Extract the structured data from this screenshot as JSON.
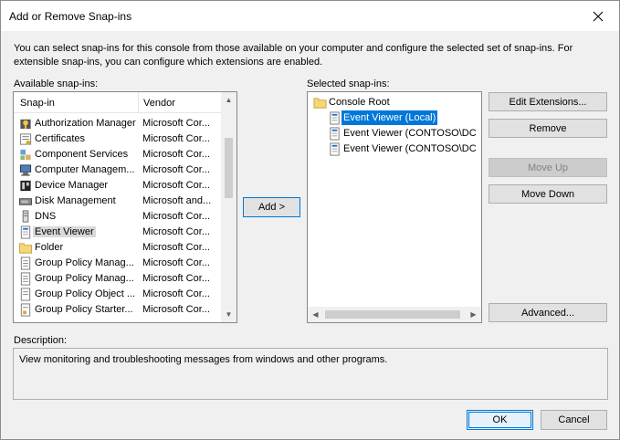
{
  "window": {
    "title": "Add or Remove Snap-ins"
  },
  "intro": "You can select snap-ins for this console from those available on your computer and configure the selected set of snap-ins. For extensible snap-ins, you can configure which extensions are enabled.",
  "available": {
    "label": "Available snap-ins:",
    "columns": {
      "snapin": "Snap-in",
      "vendor": "Vendor"
    },
    "items": [
      {
        "name": "Authorization Manager",
        "vendor": "Microsoft Cor...",
        "icon": "authorization-manager-icon"
      },
      {
        "name": "Certificates",
        "vendor": "Microsoft Cor...",
        "icon": "certificates-icon"
      },
      {
        "name": "Component Services",
        "vendor": "Microsoft Cor...",
        "icon": "component-services-icon"
      },
      {
        "name": "Computer Managem...",
        "vendor": "Microsoft Cor...",
        "icon": "computer-management-icon"
      },
      {
        "name": "Device Manager",
        "vendor": "Microsoft Cor...",
        "icon": "device-manager-icon"
      },
      {
        "name": "Disk Management",
        "vendor": "Microsoft and...",
        "icon": "disk-management-icon"
      },
      {
        "name": "DNS",
        "vendor": "Microsoft Cor...",
        "icon": "dns-icon"
      },
      {
        "name": "Event Viewer",
        "vendor": "Microsoft Cor...",
        "icon": "event-viewer-icon"
      },
      {
        "name": "Folder",
        "vendor": "Microsoft Cor...",
        "icon": "folder-icon"
      },
      {
        "name": "Group Policy Manag...",
        "vendor": "Microsoft Cor...",
        "icon": "group-policy-icon"
      },
      {
        "name": "Group Policy Manag...",
        "vendor": "Microsoft Cor...",
        "icon": "group-policy-icon"
      },
      {
        "name": "Group Policy Object ...",
        "vendor": "Microsoft Cor...",
        "icon": "group-policy-object-icon"
      },
      {
        "name": "Group Policy Starter...",
        "vendor": "Microsoft Cor...",
        "icon": "group-policy-starter-icon"
      }
    ]
  },
  "add_button": "Add >",
  "selected": {
    "label": "Selected snap-ins:",
    "root": "Console Root",
    "items": [
      "Event Viewer (Local)",
      "Event Viewer (CONTOSO\\DC",
      "Event Viewer (CONTOSO\\DC"
    ]
  },
  "buttons": {
    "edit_extensions": "Edit Extensions...",
    "remove": "Remove",
    "move_up": "Move Up",
    "move_down": "Move Down",
    "advanced": "Advanced...",
    "ok": "OK",
    "cancel": "Cancel"
  },
  "description": {
    "label": "Description:",
    "text": "View monitoring and troubleshooting messages from windows and other programs."
  }
}
